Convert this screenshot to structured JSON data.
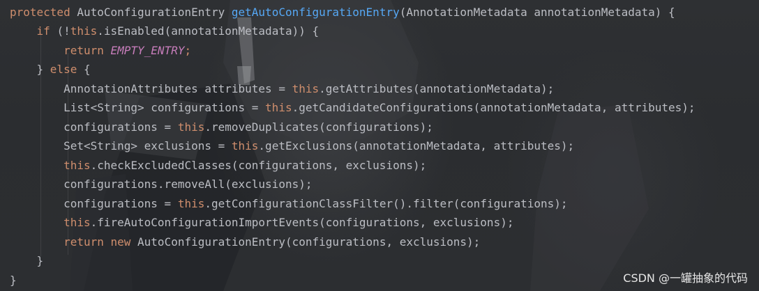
{
  "code_lines": [
    [
      {
        "t": "protected ",
        "c": "kw"
      },
      {
        "t": "AutoConfigurationEntry ",
        "c": "plain"
      },
      {
        "t": "getAutoConfigurationEntry",
        "c": "fn"
      },
      {
        "t": "(AnnotationMetadata annotationMetadata) {",
        "c": "plain"
      }
    ],
    [
      {
        "t": "    ",
        "c": "plain"
      },
      {
        "t": "if ",
        "c": "kw"
      },
      {
        "t": "(!",
        "c": "plain"
      },
      {
        "t": "this",
        "c": "kw"
      },
      {
        "t": ".isEnabled(annotationMetadata)) {",
        "c": "plain"
      }
    ],
    [
      {
        "t": "        ",
        "c": "plain"
      },
      {
        "t": "return ",
        "c": "kw"
      },
      {
        "t": "EMPTY_ENTRY",
        "c": "const"
      },
      {
        "t": ";",
        "c": "kw"
      }
    ],
    [
      {
        "t": "    } ",
        "c": "plain"
      },
      {
        "t": "else",
        "c": "kw"
      },
      {
        "t": " {",
        "c": "plain"
      }
    ],
    [
      {
        "t": "        AnnotationAttributes attributes = ",
        "c": "plain"
      },
      {
        "t": "this",
        "c": "kw"
      },
      {
        "t": ".getAttributes(annotationMetadata);",
        "c": "plain"
      }
    ],
    [
      {
        "t": "        List<String> configurations = ",
        "c": "plain"
      },
      {
        "t": "this",
        "c": "kw"
      },
      {
        "t": ".getCandidateConfigurations(annotationMetadata, attributes);",
        "c": "plain"
      }
    ],
    [
      {
        "t": "        configurations = ",
        "c": "plain"
      },
      {
        "t": "this",
        "c": "kw"
      },
      {
        "t": ".removeDuplicates(configurations);",
        "c": "plain"
      }
    ],
    [
      {
        "t": "        Set<String> exclusions = ",
        "c": "plain"
      },
      {
        "t": "this",
        "c": "kw"
      },
      {
        "t": ".getExclusions(annotationMetadata, attributes);",
        "c": "plain"
      }
    ],
    [
      {
        "t": "        ",
        "c": "plain"
      },
      {
        "t": "this",
        "c": "kw"
      },
      {
        "t": ".checkExcludedClasses(configurations, exclusions);",
        "c": "plain"
      }
    ],
    [
      {
        "t": "        configurations.removeAll(exclusions);",
        "c": "plain"
      }
    ],
    [
      {
        "t": "        configurations = ",
        "c": "plain"
      },
      {
        "t": "this",
        "c": "kw"
      },
      {
        "t": ".getConfigurationClassFilter().filter(configurations);",
        "c": "plain"
      }
    ],
    [
      {
        "t": "        ",
        "c": "plain"
      },
      {
        "t": "this",
        "c": "kw"
      },
      {
        "t": ".fireAutoConfigurationImportEvents(configurations, exclusions);",
        "c": "plain"
      }
    ],
    [
      {
        "t": "        ",
        "c": "plain"
      },
      {
        "t": "return new ",
        "c": "kw"
      },
      {
        "t": "AutoConfigurationEntry(configurations, exclusions);",
        "c": "plain"
      }
    ],
    [
      {
        "t": "    }",
        "c": "plain"
      }
    ],
    [
      {
        "t": "}",
        "c": "plain"
      }
    ]
  ],
  "watermark": "CSDN @一罐抽象的代码",
  "colors": {
    "background": "#2b2d30",
    "keyword": "#cf8e6d",
    "function": "#56a8f5",
    "constant": "#c77dbb",
    "text": "#bcbec4"
  }
}
